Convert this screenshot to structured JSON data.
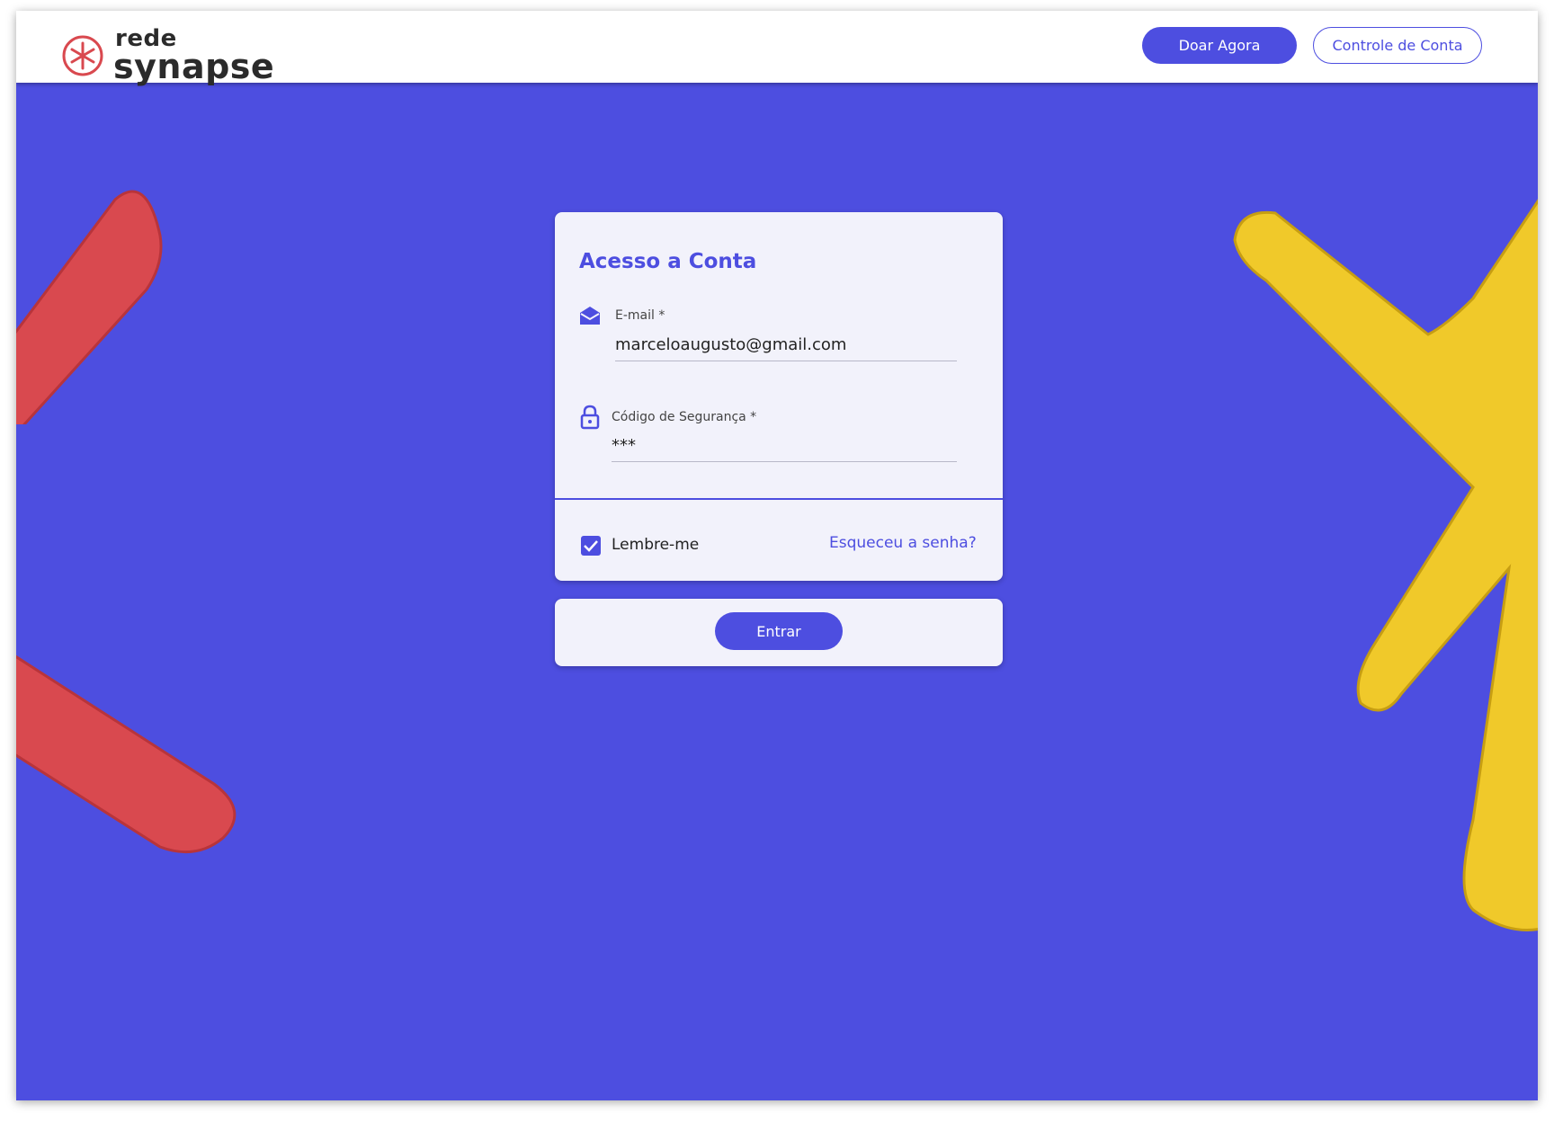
{
  "header": {
    "logo_top": "rede",
    "logo_bottom": "synapse",
    "donate_label": "Doar Agora",
    "account_label": "Controle de Conta"
  },
  "login": {
    "title": "Acesso a Conta",
    "email_label": "E-mail *",
    "email_value": "marceloaugusto@gmail.com",
    "code_label": "Código de Segurança *",
    "code_value": "***",
    "remember_label": "Lembre-me",
    "remember_checked": true,
    "forgot_label": "Esqueceu a senha?",
    "submit_label": "Entrar"
  },
  "icons": {
    "email": "envelope-open-icon",
    "code": "lock-icon",
    "checkbox": "check-icon"
  },
  "colors": {
    "primary": "#4d4ee0",
    "card_background": "#f2f2fb",
    "decor_red": "#d9494f",
    "decor_yellow": "#f0c92a"
  }
}
